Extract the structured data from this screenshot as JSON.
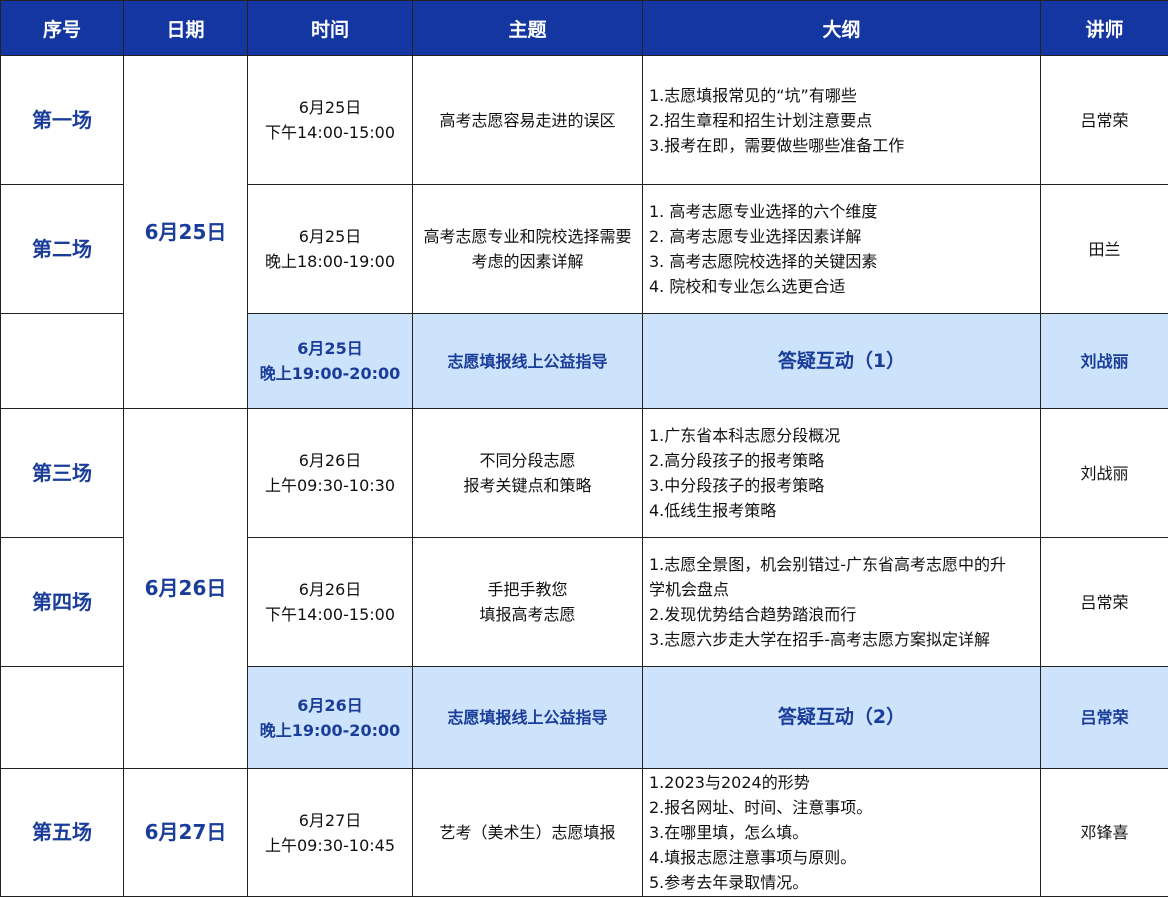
{
  "headers": [
    "序号",
    "日期",
    "时间",
    "主题",
    "大纲",
    "讲师"
  ],
  "dates": [
    "6月25日",
    "6月26日",
    "6月27日"
  ],
  "rows": [
    {
      "seq": "第一场",
      "time": [
        "6月25日",
        "下午14:00-15:00"
      ],
      "topic": [
        "高考志愿容易走进的误区"
      ],
      "outline": [
        "1.志愿填报常见的“坑”有哪些",
        "2.招生章程和招生计划注意要点",
        "3.报考在即，需要做些哪些准备工作"
      ],
      "lecturer": "吕常荣"
    },
    {
      "seq": "第二场",
      "time": [
        "6月25日",
        "晚上18:00-19:00"
      ],
      "topic": [
        "高考志愿专业和院校选择需要",
        "考虑的因素详解"
      ],
      "outline": [
        "1. 高考志愿专业选择的六个维度",
        "2. 高考志愿专业选择因素详解",
        "3. 高考志愿院校选择的关键因素",
        "4. 院校和专业怎么选更合适"
      ],
      "lecturer": "田兰"
    },
    {
      "seq": "",
      "time": [
        "6月25日",
        "晚上19:00-20:00"
      ],
      "topic": [
        "志愿填报线上公益指导"
      ],
      "outline": [
        "答疑互动（1）"
      ],
      "lecturer": "刘战丽"
    },
    {
      "seq": "第三场",
      "time": [
        "6月26日",
        "上午09:30-10:30"
      ],
      "topic": [
        "不同分段志愿",
        "报考关键点和策略"
      ],
      "outline": [
        "1.广东省本科志愿分段概况",
        "2.高分段孩子的报考策略",
        "3.中分段孩子的报考策略",
        "4.低线生报考策略"
      ],
      "lecturer": "刘战丽"
    },
    {
      "seq": "第四场",
      "time": [
        "6月26日",
        "下午14:00-15:00"
      ],
      "topic": [
        "手把手教您",
        "填报高考志愿"
      ],
      "outline": [
        "1.志愿全景图，机会别错过-广东省高考志愿中的升",
        "学机会盘点",
        "2.发现优势结合趋势踏浪而行",
        "3.志愿六步走大学在招手-高考志愿方案拟定详解"
      ],
      "lecturer": "吕常荣"
    },
    {
      "seq": "",
      "time": [
        "6月26日",
        "晚上19:00-20:00"
      ],
      "topic": [
        "志愿填报线上公益指导"
      ],
      "outline": [
        "答疑互动（2）"
      ],
      "lecturer": "吕常荣"
    },
    {
      "seq": "第五场",
      "time": [
        "6月27日",
        "上午09:30-10:45"
      ],
      "topic": [
        "艺考（美术生）志愿填报"
      ],
      "outline": [
        "1.2023与2024的形势",
        "2.报名网址、时间、注意事项。",
        "3.在哪里填，怎么填。",
        "4.填报志愿注意事项与原则。",
        "5.参考去年录取情况。"
      ],
      "lecturer": "邓锋喜"
    }
  ],
  "colors": {
    "header_bg": "#1336a0",
    "highlight_bg": "#cde3fb",
    "accent_text": "#1a3d99"
  }
}
